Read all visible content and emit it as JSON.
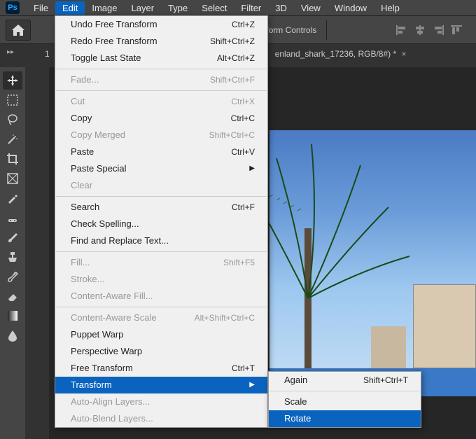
{
  "menubar": {
    "items": [
      "File",
      "Edit",
      "Image",
      "Layer",
      "Type",
      "Select",
      "Filter",
      "3D",
      "View",
      "Window",
      "Help"
    ],
    "active_index": 1
  },
  "optionsbar": {
    "text": "Transform Controls"
  },
  "tab": {
    "prefix": "1",
    "name": "enland_shark_17236, RGB/8#) *",
    "close": "×"
  },
  "edit_menu": {
    "groups": [
      [
        {
          "label": "Undo Free Transform",
          "shortcut": "Ctrl+Z",
          "enabled": true
        },
        {
          "label": "Redo Free Transform",
          "shortcut": "Shift+Ctrl+Z",
          "enabled": true
        },
        {
          "label": "Toggle Last State",
          "shortcut": "Alt+Ctrl+Z",
          "enabled": true
        }
      ],
      [
        {
          "label": "Fade...",
          "shortcut": "Shift+Ctrl+F",
          "enabled": false
        }
      ],
      [
        {
          "label": "Cut",
          "shortcut": "Ctrl+X",
          "enabled": false
        },
        {
          "label": "Copy",
          "shortcut": "Ctrl+C",
          "enabled": true
        },
        {
          "label": "Copy Merged",
          "shortcut": "Shift+Ctrl+C",
          "enabled": false
        },
        {
          "label": "Paste",
          "shortcut": "Ctrl+V",
          "enabled": true
        },
        {
          "label": "Paste Special",
          "shortcut": "",
          "enabled": true,
          "submenu": true
        },
        {
          "label": "Clear",
          "shortcut": "",
          "enabled": false
        }
      ],
      [
        {
          "label": "Search",
          "shortcut": "Ctrl+F",
          "enabled": true
        },
        {
          "label": "Check Spelling...",
          "shortcut": "",
          "enabled": true
        },
        {
          "label": "Find and Replace Text...",
          "shortcut": "",
          "enabled": true
        }
      ],
      [
        {
          "label": "Fill...",
          "shortcut": "Shift+F5",
          "enabled": false
        },
        {
          "label": "Stroke...",
          "shortcut": "",
          "enabled": false
        },
        {
          "label": "Content-Aware Fill...",
          "shortcut": "",
          "enabled": false
        }
      ],
      [
        {
          "label": "Content-Aware Scale",
          "shortcut": "Alt+Shift+Ctrl+C",
          "enabled": false
        },
        {
          "label": "Puppet Warp",
          "shortcut": "",
          "enabled": true
        },
        {
          "label": "Perspective Warp",
          "shortcut": "",
          "enabled": true
        },
        {
          "label": "Free Transform",
          "shortcut": "Ctrl+T",
          "enabled": true
        },
        {
          "label": "Transform",
          "shortcut": "",
          "enabled": true,
          "submenu": true,
          "highlight": true
        },
        {
          "label": "Auto-Align Layers...",
          "shortcut": "",
          "enabled": false
        },
        {
          "label": "Auto-Blend Layers...",
          "shortcut": "",
          "enabled": false
        }
      ]
    ]
  },
  "submenu": {
    "groups": [
      [
        {
          "label": "Again",
          "shortcut": "Shift+Ctrl+T",
          "enabled": true
        }
      ],
      [
        {
          "label": "Scale",
          "shortcut": "",
          "enabled": true
        },
        {
          "label": "Rotate",
          "shortcut": "",
          "enabled": true,
          "highlight": true
        }
      ]
    ]
  },
  "tools": [
    "move",
    "marquee",
    "lasso",
    "magic-wand",
    "crop",
    "frame",
    "eyedropper",
    "healing",
    "brush",
    "clone",
    "history",
    "eraser",
    "gradient",
    "blur"
  ]
}
